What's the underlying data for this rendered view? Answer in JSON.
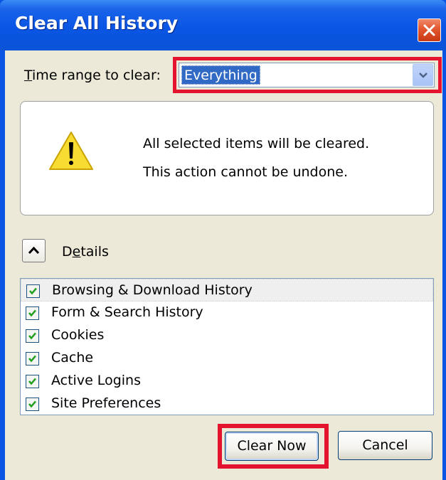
{
  "window": {
    "title": "Clear All History"
  },
  "time_range": {
    "label_prefix": "",
    "label_accel": "T",
    "label_rest": "ime range to clear:",
    "selected": "Everything"
  },
  "warning": {
    "line1": "All selected items will be cleared.",
    "line2": "This action cannot be undone."
  },
  "details": {
    "label_prefix": "D",
    "label_accel": "e",
    "label_rest": "tails",
    "expanded": true
  },
  "items": [
    {
      "label": "Browsing & Download History",
      "checked": true
    },
    {
      "label": "Form & Search History",
      "checked": true
    },
    {
      "label": "Cookies",
      "checked": true
    },
    {
      "label": "Cache",
      "checked": true
    },
    {
      "label": "Active Logins",
      "checked": true
    },
    {
      "label": "Site Preferences",
      "checked": true
    }
  ],
  "buttons": {
    "clear_now": "Clear Now",
    "cancel": "Cancel"
  },
  "colors": {
    "titlebar": "#0a55e4",
    "highlight": "#e4142e",
    "dialog_bg": "#ece9d8",
    "selection": "#316ac5"
  },
  "icons": {
    "close": "close-icon",
    "warning": "warning-icon",
    "dropdown": "chevron-down-icon",
    "toggle": "chevron-up-icon",
    "check": "check-icon"
  }
}
